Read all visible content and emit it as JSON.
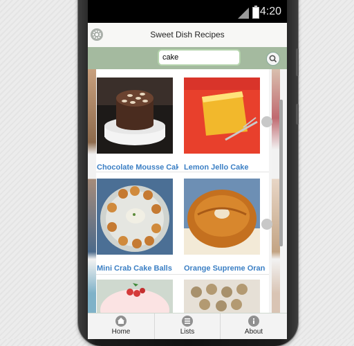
{
  "status": {
    "time": "4:20"
  },
  "header": {
    "title": "Sweet Dish Recipes"
  },
  "search": {
    "value": "cake"
  },
  "recipes": [
    {
      "name": "Chocolate Mousse Cake"
    },
    {
      "name": "Lemon Jello Cake"
    },
    {
      "name": "Mini Crab Cake Balls"
    },
    {
      "name": "Orange Supreme Orange Bundt Cake"
    },
    {
      "name": ""
    },
    {
      "name": ""
    }
  ],
  "footer": {
    "tabs": [
      {
        "label": "Home",
        "icon": "home-icon"
      },
      {
        "label": "Lists",
        "icon": "list-icon"
      },
      {
        "label": "About",
        "icon": "info-icon"
      }
    ]
  },
  "colors": {
    "search_bar": "#a4ba9f",
    "link": "#3b7fc4",
    "status_bar": "#000000"
  }
}
